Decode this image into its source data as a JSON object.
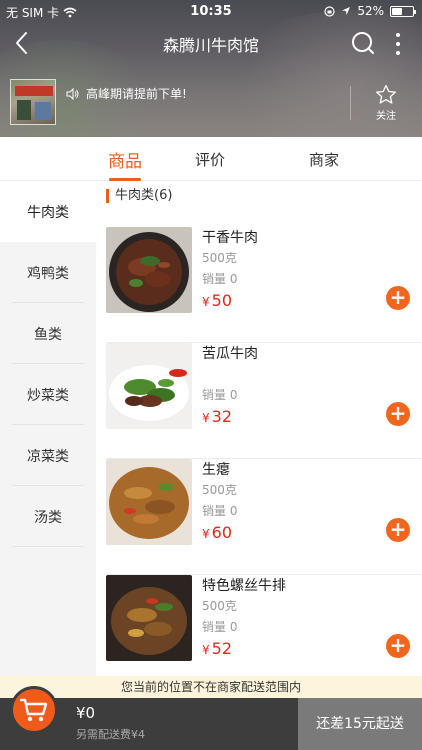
{
  "status_bar": {
    "carrier": "无 SIM 卡",
    "time": "10:35",
    "battery": "52%",
    "battery_level": 0.52
  },
  "nav": {
    "title": "森腾川牛肉馆"
  },
  "shop": {
    "notice": "高峰期请提前下单!",
    "favorite_label": "关注"
  },
  "tabs": [
    {
      "label": "商品",
      "active": true
    },
    {
      "label": "评价",
      "active": false
    },
    {
      "label": "商家",
      "active": false
    }
  ],
  "sidebar": {
    "items": [
      {
        "label": "牛肉类",
        "active": true
      },
      {
        "label": "鸡鸭类",
        "active": false
      },
      {
        "label": "鱼类",
        "active": false
      },
      {
        "label": "炒菜类",
        "active": false
      },
      {
        "label": "凉菜类",
        "active": false
      },
      {
        "label": "汤类",
        "active": false
      }
    ]
  },
  "section": {
    "title": "牛肉类(6)"
  },
  "dishes": [
    {
      "name": "干香牛肉",
      "spec": "500克",
      "sales": "销量 0",
      "currency": "¥",
      "price": "50"
    },
    {
      "name": "苦瓜牛肉",
      "spec": "",
      "sales": "销量 0",
      "currency": "¥",
      "price": "32"
    },
    {
      "name": "生瘪",
      "spec": "500克",
      "sales": "销量 0",
      "currency": "¥",
      "price": "60"
    },
    {
      "name": "特色螺丝牛排",
      "spec": "500克",
      "sales": "销量 0",
      "currency": "¥",
      "price": "52"
    }
  ],
  "add_label": "+",
  "cart": {
    "warning": "您当前的位置不在商家配送范围内",
    "total": "¥0",
    "delivery_fee": "另需配送费¥4",
    "checkout_label": "还差15元起送"
  },
  "colors": {
    "accent": "#e8601c",
    "price": "#e0281e",
    "cart_bar": "#3d3d3d"
  }
}
